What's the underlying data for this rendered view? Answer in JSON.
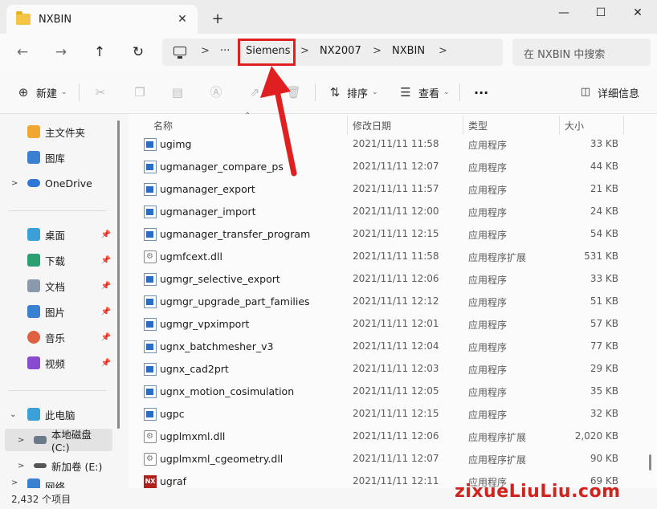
{
  "window": {
    "tab_title": "NXBIN",
    "tab_close": "✕",
    "new_tab": "+",
    "minimize": "—",
    "maximize": "☐",
    "close": "✕"
  },
  "nav": {
    "back": "←",
    "forward": "→",
    "up": "↑",
    "refresh": "↻"
  },
  "address": {
    "more": "···",
    "separator": ">",
    "crumbs": [
      "Siemens",
      "NX2007",
      "NXBIN"
    ],
    "search_placeholder": "在 NXBIN 中搜索"
  },
  "toolbar": {
    "new_label": "新建",
    "sort_label": "排序",
    "view_label": "查看",
    "more": "···",
    "details_label": "详细信息"
  },
  "sidebar": {
    "home": "主文件夹",
    "gallery": "图库",
    "onedrive": "OneDrive",
    "desktop": "桌面",
    "downloads": "下载",
    "documents": "文档",
    "pictures": "图片",
    "music": "音乐",
    "videos": "视频",
    "this_pc": "此电脑",
    "local_disk": "本地磁盘 (C:)",
    "new_volume": "新加卷 (E:)",
    "network": "网络"
  },
  "columns": {
    "name": "名称",
    "modified": "修改日期",
    "type": "类型",
    "size": "大小"
  },
  "files": [
    {
      "name": "ugimg",
      "date": "2021/11/11 11:58",
      "type": "应用程序",
      "size": "33 KB",
      "icon": "exe"
    },
    {
      "name": "ugmanager_compare_ps",
      "date": "2021/11/11 12:07",
      "type": "应用程序",
      "size": "44 KB",
      "icon": "exe"
    },
    {
      "name": "ugmanager_export",
      "date": "2021/11/11 11:57",
      "type": "应用程序",
      "size": "21 KB",
      "icon": "exe"
    },
    {
      "name": "ugmanager_import",
      "date": "2021/11/11 12:00",
      "type": "应用程序",
      "size": "24 KB",
      "icon": "exe"
    },
    {
      "name": "ugmanager_transfer_program",
      "date": "2021/11/11 12:15",
      "type": "应用程序",
      "size": "54 KB",
      "icon": "exe"
    },
    {
      "name": "ugmfcext.dll",
      "date": "2021/11/11 11:58",
      "type": "应用程序扩展",
      "size": "531 KB",
      "icon": "dll"
    },
    {
      "name": "ugmgr_selective_export",
      "date": "2021/11/11 12:06",
      "type": "应用程序",
      "size": "33 KB",
      "icon": "exe"
    },
    {
      "name": "ugmgr_upgrade_part_families",
      "date": "2021/11/11 12:12",
      "type": "应用程序",
      "size": "51 KB",
      "icon": "exe"
    },
    {
      "name": "ugmgr_vpximport",
      "date": "2021/11/11 12:01",
      "type": "应用程序",
      "size": "57 KB",
      "icon": "exe"
    },
    {
      "name": "ugnx_batchmesher_v3",
      "date": "2021/11/11 12:04",
      "type": "应用程序",
      "size": "77 KB",
      "icon": "exe"
    },
    {
      "name": "ugnx_cad2prt",
      "date": "2021/11/11 12:03",
      "type": "应用程序",
      "size": "29 KB",
      "icon": "exe"
    },
    {
      "name": "ugnx_motion_cosimulation",
      "date": "2021/11/11 12:05",
      "type": "应用程序",
      "size": "35 KB",
      "icon": "exe"
    },
    {
      "name": "ugpc",
      "date": "2021/11/11 12:15",
      "type": "应用程序",
      "size": "32 KB",
      "icon": "exe"
    },
    {
      "name": "ugplmxml.dll",
      "date": "2021/11/11 12:06",
      "type": "应用程序扩展",
      "size": "2,020 KB",
      "icon": "dll"
    },
    {
      "name": "ugplmxml_cgeometry.dll",
      "date": "2021/11/11 12:07",
      "type": "应用程序扩展",
      "size": "90 KB",
      "icon": "dll"
    },
    {
      "name": "ugraf",
      "date": "2021/11/11 12:11",
      "type": "应用程序",
      "size": "69 KB",
      "icon": "nx"
    }
  ],
  "status": {
    "item_count": "2,432 个项目"
  },
  "watermark": "zixueLiuLiu.com",
  "colors": {
    "highlight": "#e02020",
    "accent": "#2b6cc4"
  }
}
